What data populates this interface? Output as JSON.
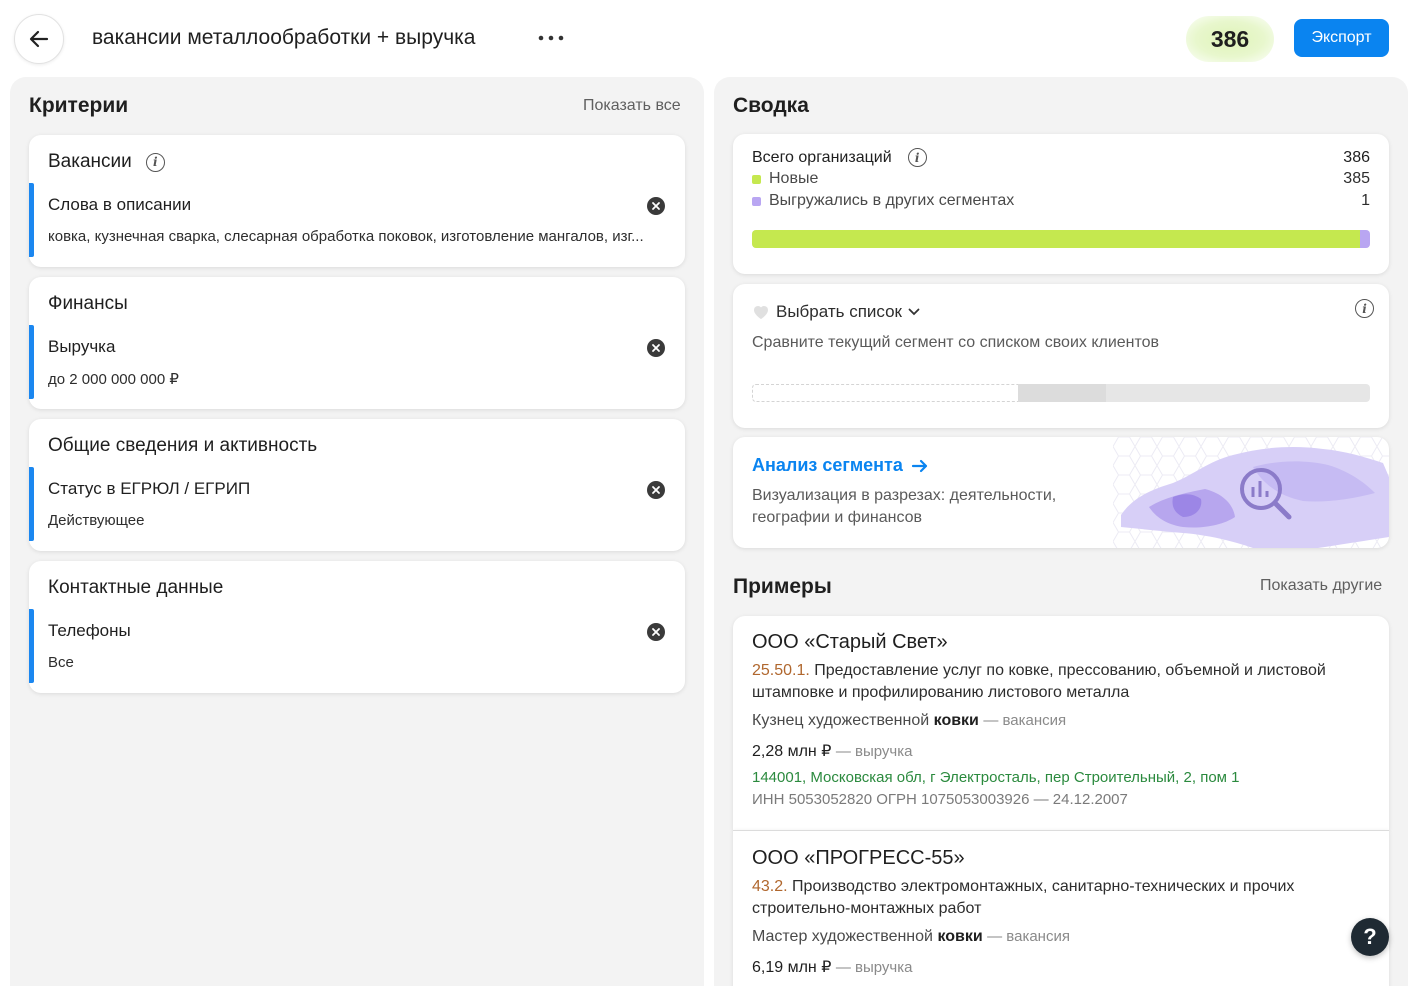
{
  "header": {
    "back_icon": "arrow-left-icon",
    "title": "вакансии металлообработки + выручка",
    "more_icon": "more-horizontal-icon",
    "count": "386",
    "export_label": "Экспорт",
    "accent": "#0a84f0"
  },
  "criteria": {
    "heading": "Критерии",
    "show_all": "Показать все",
    "cards": [
      {
        "title": "Вакансии",
        "name": "Слова в описании",
        "value": "ковка, кузнечная сварка, слесарная обработка поковок, изготовление мангалов, изг..."
      },
      {
        "title": "Финансы",
        "name": "Выручка",
        "value": "до 2 000 000 000 ₽"
      },
      {
        "title": "Общие сведения и активность",
        "name": "Статус в ЕГРЮЛ / ЕГРИП",
        "value": "Действующее"
      },
      {
        "title": "Контактные данные",
        "name": "Телефоны",
        "value": "Все"
      }
    ]
  },
  "summary": {
    "heading": "Сводка",
    "total_label": "Всего организаций",
    "total_value": "386",
    "new_label": "Новые",
    "new_value": "385",
    "other_label": "Выгружались в других сегментах",
    "other_value": "1",
    "new_color": "#c5e84f",
    "other_color": "#b9a6f2",
    "new_fraction": 0.9974,
    "other_fraction": 0.0026
  },
  "list_card": {
    "title": "Выбрать список",
    "description": "Сравните текущий сегмент со списком своих клиентов"
  },
  "analysis": {
    "title": "Анализ сегмента",
    "description": "Визуализация в разрезах: деятельности, географии и финансов"
  },
  "examples": {
    "heading": "Примеры",
    "show_other": "Показать другие",
    "items": [
      {
        "name": "ООО «Старый Свет»",
        "okved_code": "25.50.1.",
        "okved_text": "Предоставление услуг по ковке, прессованию, объемной и листовой штамповке и профилированию листового металла",
        "vacancy_prefix": "Кузнец художественной",
        "vacancy_keyword": "ковки",
        "vacancy_suffix": "— вакансия",
        "revenue": "2,28 млн ₽",
        "revenue_suffix": "— выручка",
        "address": "144001, Московская обл, г Электросталь, пер Строительный, 2, пом 1",
        "ids": "ИНН 5053052820   ОГРН 1075053003926 — 24.12.2007"
      },
      {
        "name": "ООО «ПРОГРЕСС-55»",
        "okved_code": "43.2.",
        "okved_text": "Производство электромонтажных, санитарно-технических и прочих строительно-монтажных работ",
        "vacancy_prefix": "Мастер художественной",
        "vacancy_keyword": "ковки",
        "vacancy_suffix": "— вакансия",
        "revenue": "6,19 млн ₽",
        "revenue_suffix": "— выручка"
      }
    ]
  },
  "help_label": "?"
}
